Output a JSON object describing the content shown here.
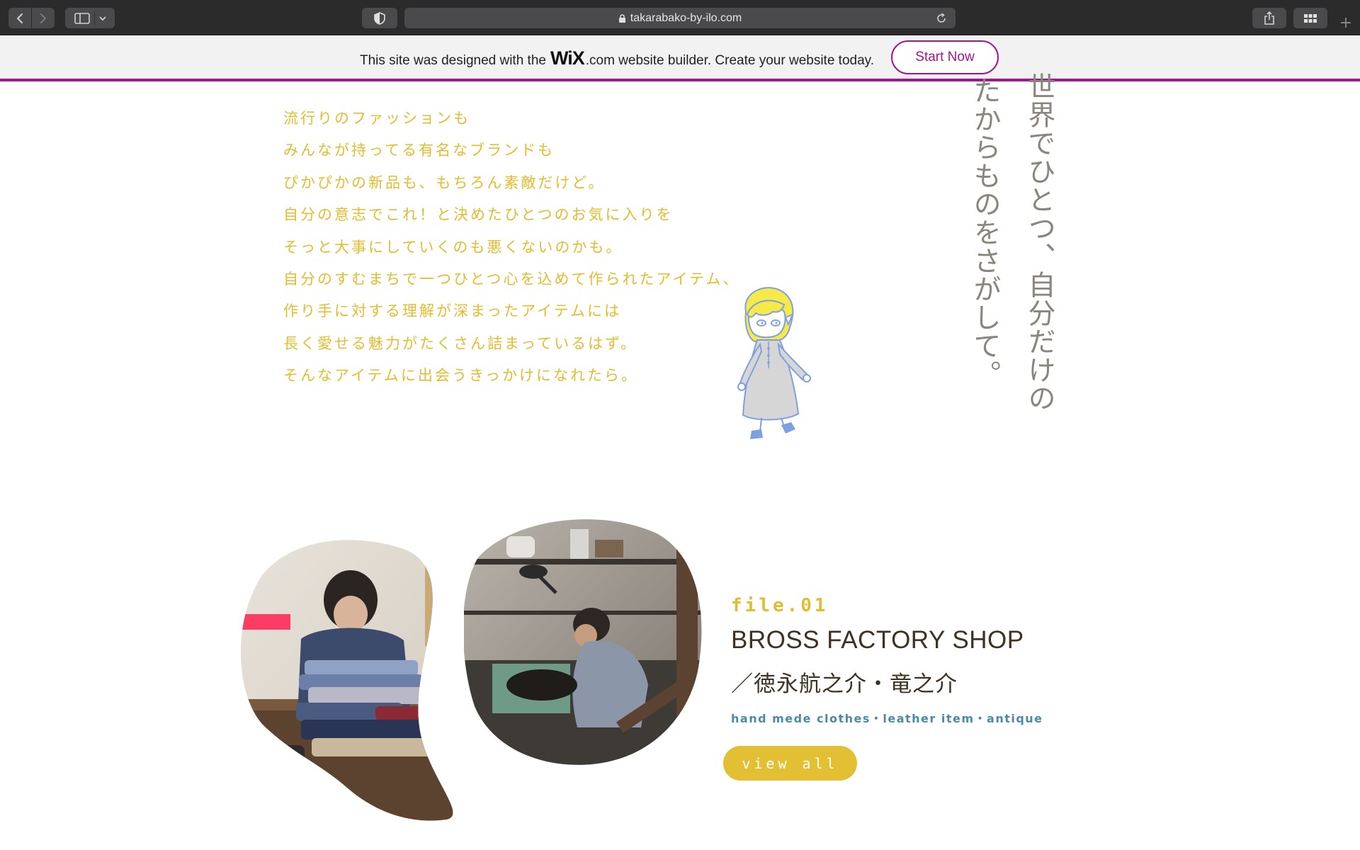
{
  "browser": {
    "url": "takarabako-by-ilo.com",
    "icons": {
      "back": "chevron-left-icon",
      "forward": "chevron-right-icon",
      "sidebar": "sidebar-icon",
      "privacy": "shield-icon",
      "lock": "lock-icon",
      "reload": "reload-icon",
      "share": "share-icon",
      "tabs": "tab-overview-icon",
      "new_tab": "plus-icon"
    },
    "new_tab_glyph": "+"
  },
  "wix_banner": {
    "text_before": "This site was designed with the",
    "logo": "WiX",
    "text_after": ".com website builder. Create your website today.",
    "button_label": "Start Now",
    "accent_color": "#a1168f"
  },
  "intro": {
    "lines": [
      "流行りのファッションも",
      "みんなが持ってる有名なブランドも",
      "ぴかぴかの新品も、もちろん素敵だけど。",
      "自分の意志でこれ！と決めたひとつのお気に入りを",
      "そっと大事にしていくのも悪くないのかも。",
      "自分のすむまちで一つひとつ心を込めて作られたアイテム、",
      "作り手に対する理解が深まったアイテムには",
      "長く愛せる魅力がたくさん詰まっているはず。",
      "そんなアイテムに出会うきっかけになれたら。"
    ],
    "color": "#e1bd2f"
  },
  "tagline": {
    "line1": "世界でひとつ、自分だけの",
    "line2": "たからものをさがして。",
    "color": "#8a857d"
  },
  "feature": {
    "file_label": "file.01",
    "title": "BROSS FACTORY SHOP",
    "people": "／徳永航之介・竜之介",
    "tags": "hand mede clothes・leather item・antique",
    "button_label": "view all",
    "button_color": "#e2bf33",
    "tag_color": "#4a8aa6"
  }
}
